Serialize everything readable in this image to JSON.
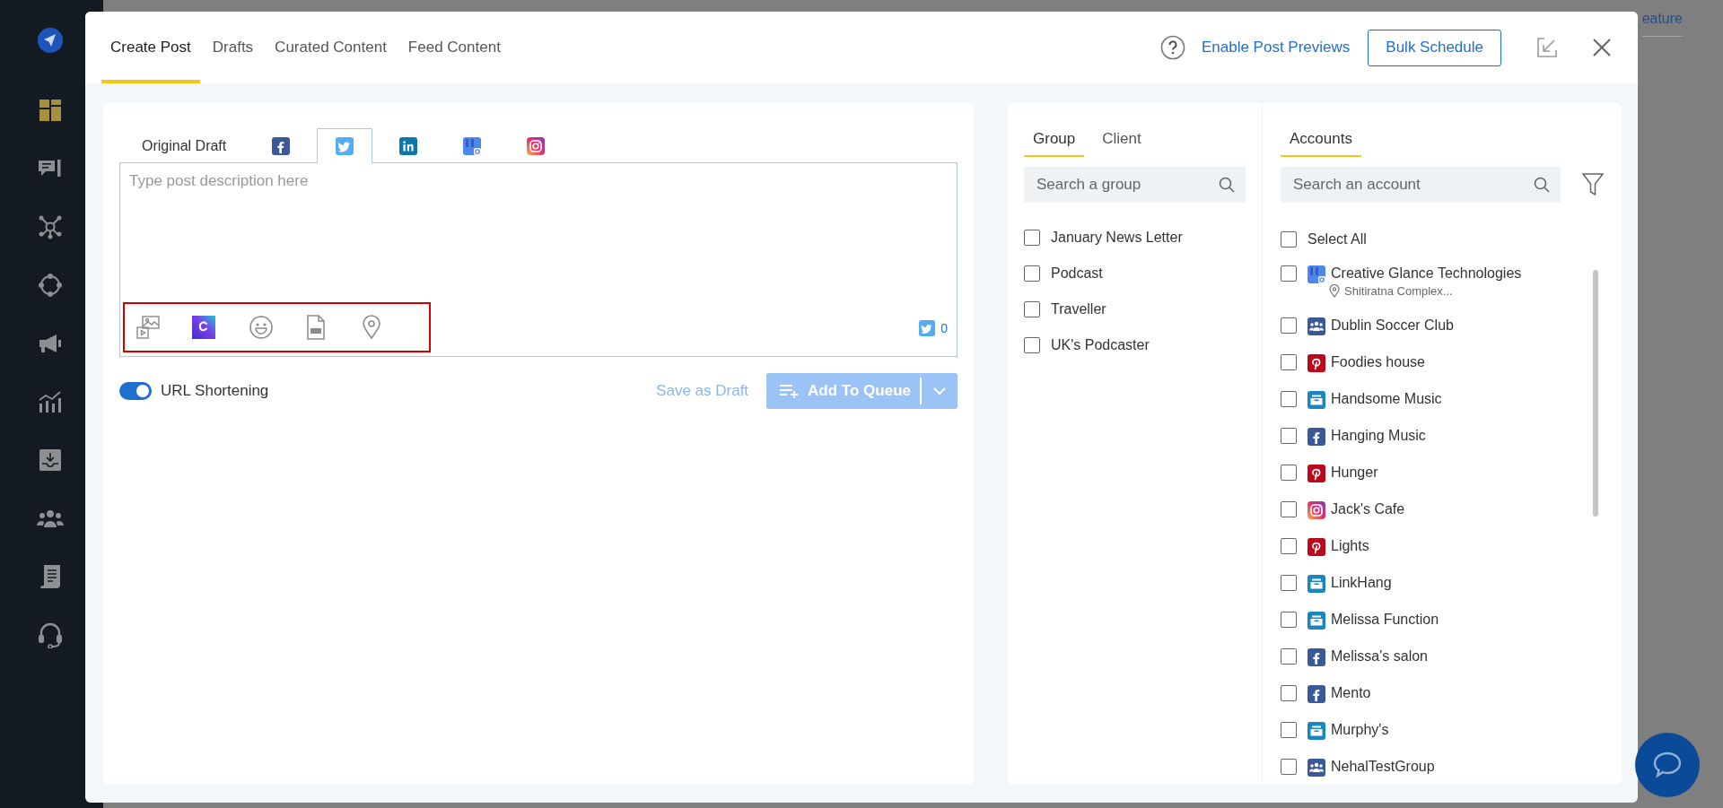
{
  "background_page": {
    "link_text": "eature"
  },
  "sidebar": {
    "items": [
      {
        "kind": "dashboard",
        "selected": true
      },
      {
        "kind": "chat",
        "selected": false
      },
      {
        "kind": "network",
        "selected": false
      },
      {
        "kind": "orbit",
        "selected": false
      },
      {
        "kind": "megaphone",
        "selected": false
      },
      {
        "kind": "chart",
        "selected": false
      },
      {
        "kind": "inbox",
        "selected": false
      },
      {
        "kind": "team",
        "selected": false
      },
      {
        "kind": "document",
        "selected": false
      },
      {
        "kind": "headset",
        "selected": false
      }
    ]
  },
  "modal": {
    "tabs": [
      {
        "label": "Create Post",
        "selected": true
      },
      {
        "label": "Drafts",
        "selected": false
      },
      {
        "label": "Curated Content",
        "selected": false
      },
      {
        "label": "Feed Content",
        "selected": false
      }
    ],
    "preview_link": "Enable Post Previews",
    "bulk_button": "Bulk Schedule"
  },
  "composer": {
    "tabs": [
      {
        "kind": "text",
        "label": "Original Draft",
        "selected": false
      },
      {
        "kind": "facebook",
        "selected": false
      },
      {
        "kind": "twitter",
        "selected": true
      },
      {
        "kind": "linkedin",
        "selected": false
      },
      {
        "kind": "google",
        "selected": false
      },
      {
        "kind": "instagram",
        "selected": false
      }
    ],
    "placeholder": "Type post description here",
    "tools": [
      {
        "kind": "media"
      },
      {
        "kind": "canva"
      },
      {
        "kind": "emoji"
      },
      {
        "kind": "gif"
      },
      {
        "kind": "location"
      }
    ],
    "counter": {
      "kind": "twitter",
      "value": "0"
    },
    "url_shortening": {
      "label": "URL Shortening",
      "on": true
    },
    "save_draft": "Save as Draft",
    "add_to_queue": {
      "label": "Add To Queue",
      "disabled": true
    }
  },
  "groups": {
    "tabs": [
      {
        "label": "Group",
        "selected": true
      },
      {
        "label": "Client",
        "selected": false
      }
    ],
    "placeholder": "Search a group",
    "items": [
      {
        "label": "January News Letter",
        "checked": false
      },
      {
        "label": "Podcast",
        "checked": false
      },
      {
        "label": "Traveller",
        "checked": false
      },
      {
        "label": "UK's Podcaster",
        "checked": false
      }
    ]
  },
  "accounts": {
    "tabs": [
      {
        "label": "Accounts",
        "selected": true
      }
    ],
    "placeholder": "Search an account",
    "select_all": {
      "label": "Select All",
      "checked": false
    },
    "items": [
      {
        "name": "Creative Glance Technologies",
        "kind": "google",
        "checked": false,
        "subtitle": "Shitiratna Complex..."
      },
      {
        "name": "Dublin Soccer Club",
        "kind": "group",
        "checked": false
      },
      {
        "name": "Foodies house",
        "kind": "pinterest",
        "checked": false
      },
      {
        "name": "Handsome Music",
        "kind": "company",
        "checked": false
      },
      {
        "name": "Hanging Music",
        "kind": "facebook",
        "checked": false
      },
      {
        "name": "Hunger",
        "kind": "pinterest",
        "checked": false
      },
      {
        "name": "Jack's Cafe",
        "kind": "instagram",
        "checked": false
      },
      {
        "name": "Lights",
        "kind": "pinterest",
        "checked": false
      },
      {
        "name": "LinkHang",
        "kind": "company",
        "checked": false
      },
      {
        "name": "Melissa Function",
        "kind": "company",
        "checked": false
      },
      {
        "name": "Melissa's salon",
        "kind": "facebook",
        "checked": false
      },
      {
        "name": "Mento",
        "kind": "facebook",
        "checked": false
      },
      {
        "name": "Murphy's",
        "kind": "company",
        "checked": false
      },
      {
        "name": "NehalTestGroup",
        "kind": "group",
        "checked": false
      }
    ]
  }
}
